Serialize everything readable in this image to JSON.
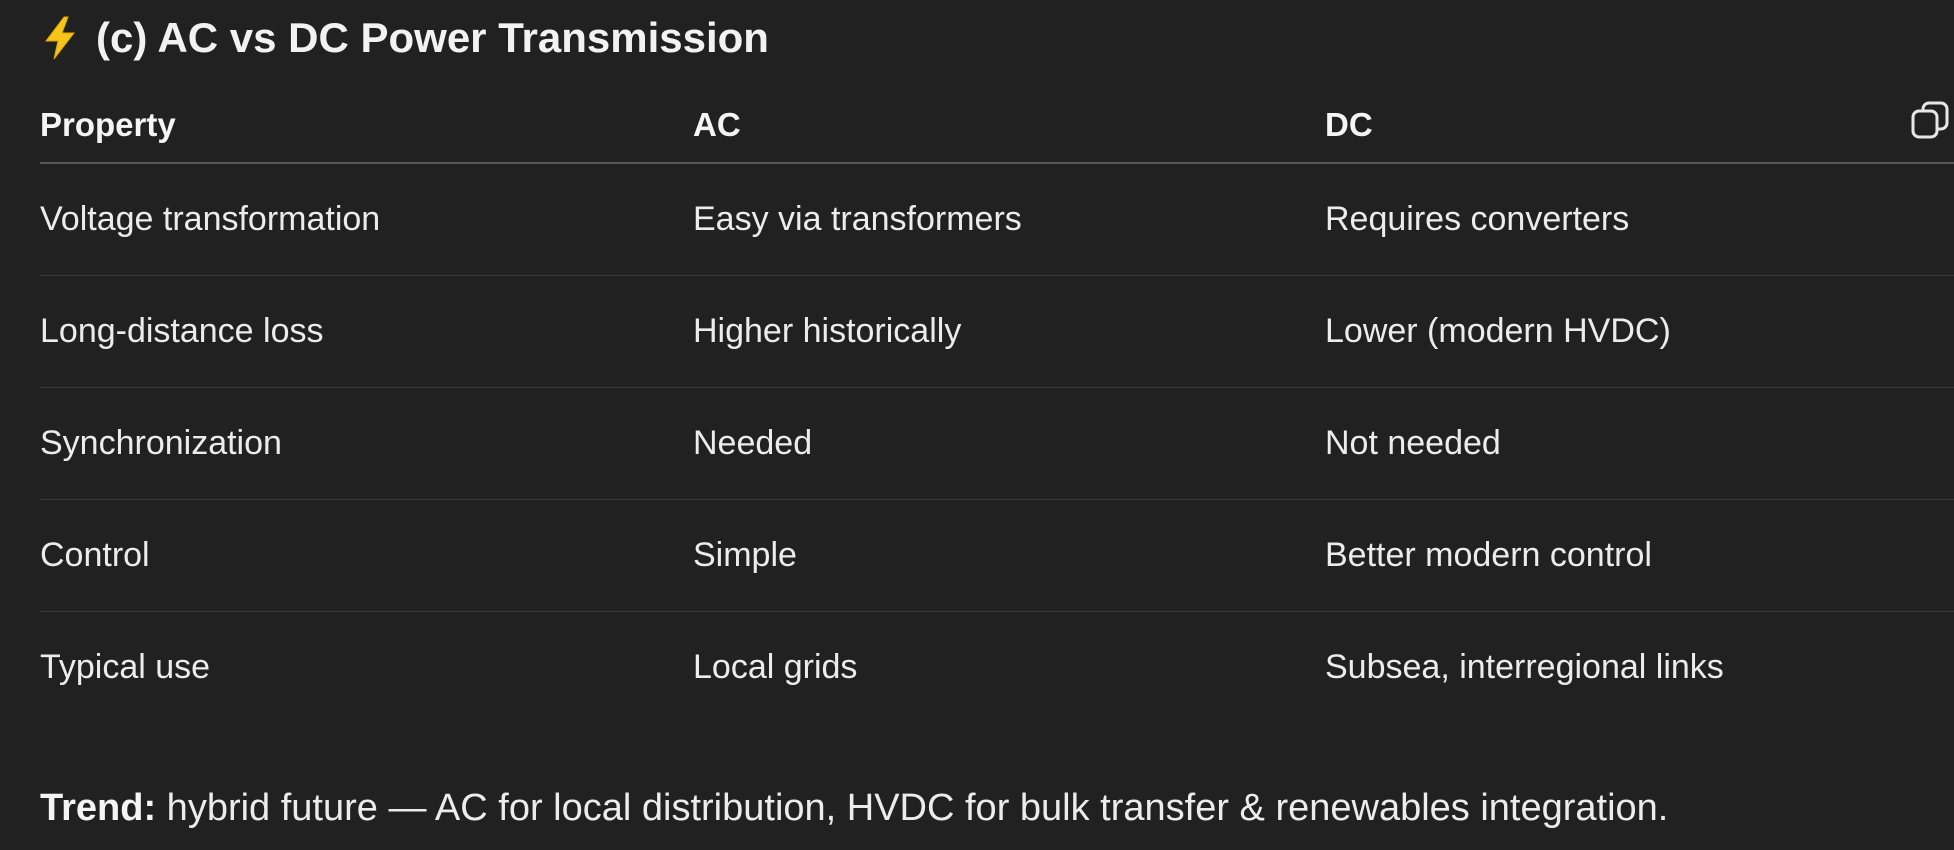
{
  "heading": {
    "emoji": "⚡",
    "title": "(c) AC vs DC Power Transmission"
  },
  "table": {
    "columns": [
      "Property",
      "AC",
      "DC"
    ],
    "rows": [
      [
        "Voltage transformation",
        "Easy via transformers",
        "Requires converters"
      ],
      [
        "Long-distance loss",
        "Higher historically",
        "Lower (modern HVDC)"
      ],
      [
        "Synchronization",
        "Needed",
        "Not needed"
      ],
      [
        "Control",
        "Simple",
        "Better modern control"
      ],
      [
        "Typical use",
        "Local grids",
        "Subsea, interregional links"
      ]
    ],
    "copy_icon": "copy-icon"
  },
  "trend": {
    "label": "Trend:",
    "text": " hybrid future — AC for local distribution, HVDC for bulk transfer & renewables integration."
  },
  "colors": {
    "background": "#212121",
    "text": "#ececec",
    "divider": "#393939",
    "bolt": "#f5c518"
  }
}
